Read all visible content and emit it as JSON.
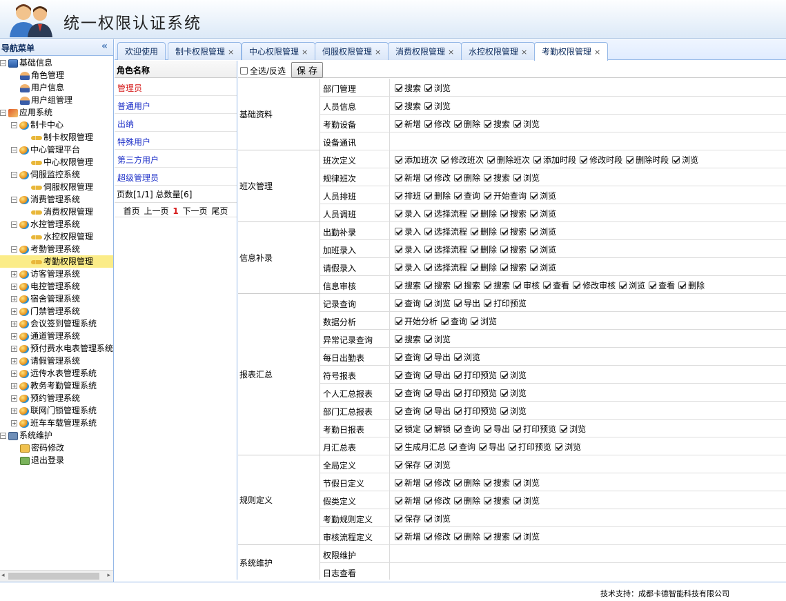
{
  "app": {
    "title": "统一权限认证系统"
  },
  "nav": {
    "title": "导航菜单",
    "tree": [
      {
        "level": 0,
        "toggle": "-",
        "icon": "grid-icon",
        "label": "基础信息"
      },
      {
        "level": 1,
        "icon": "role-icon",
        "label": "角色管理"
      },
      {
        "level": 1,
        "icon": "user-icon",
        "label": "用户信息"
      },
      {
        "level": 1,
        "icon": "user-group-icon",
        "label": "用户组管理"
      },
      {
        "level": 0,
        "toggle": "-",
        "icon": "home-icon",
        "label": "应用系统"
      },
      {
        "level": 1,
        "toggle": "-",
        "icon": "globe-icon",
        "label": "制卡中心"
      },
      {
        "level": 2,
        "icon": "key-icon",
        "label": "制卡权限管理"
      },
      {
        "level": 1,
        "toggle": "-",
        "icon": "globe-icon",
        "label": "中心管理平台"
      },
      {
        "level": 2,
        "icon": "key-icon",
        "label": "中心权限管理"
      },
      {
        "level": 1,
        "toggle": "-",
        "icon": "globe-icon",
        "label": "伺服监控系统"
      },
      {
        "level": 2,
        "icon": "key-icon",
        "label": "伺服权限管理"
      },
      {
        "level": 1,
        "toggle": "-",
        "icon": "globe-icon",
        "label": "消费管理系统"
      },
      {
        "level": 2,
        "icon": "key-icon",
        "label": "消费权限管理"
      },
      {
        "level": 1,
        "toggle": "-",
        "icon": "globe-icon",
        "label": "水控管理系统"
      },
      {
        "level": 2,
        "icon": "key-icon",
        "label": "水控权限管理"
      },
      {
        "level": 1,
        "toggle": "-",
        "icon": "globe-icon",
        "label": "考勤管理系统"
      },
      {
        "level": 2,
        "icon": "key-icon",
        "label": "考勤权限管理",
        "selected": true
      },
      {
        "level": 1,
        "toggle": "+",
        "icon": "globe-icon",
        "label": "访客管理系统"
      },
      {
        "level": 1,
        "toggle": "+",
        "icon": "globe-icon",
        "label": "电控管理系统"
      },
      {
        "level": 1,
        "toggle": "+",
        "icon": "globe-icon",
        "label": "宿舍管理系统"
      },
      {
        "level": 1,
        "toggle": "+",
        "icon": "globe-icon",
        "label": "门禁管理系统"
      },
      {
        "level": 1,
        "toggle": "+",
        "icon": "globe-icon",
        "label": "会议签到管理系统"
      },
      {
        "level": 1,
        "toggle": "+",
        "icon": "globe-icon",
        "label": "通道管理系统"
      },
      {
        "level": 1,
        "toggle": "+",
        "icon": "globe-icon",
        "label": "预付费水电表管理系统"
      },
      {
        "level": 1,
        "toggle": "+",
        "icon": "globe-icon",
        "label": "请假管理系统"
      },
      {
        "level": 1,
        "toggle": "+",
        "icon": "globe-icon",
        "label": "远传水表管理系统"
      },
      {
        "level": 1,
        "toggle": "+",
        "icon": "globe-icon",
        "label": "教务考勤管理系统"
      },
      {
        "level": 1,
        "toggle": "+",
        "icon": "globe-icon",
        "label": "预约管理系统"
      },
      {
        "level": 1,
        "toggle": "+",
        "icon": "globe-icon",
        "label": "联网门锁管理系统"
      },
      {
        "level": 1,
        "toggle": "+",
        "icon": "globe-icon",
        "label": "班车车载管理系统"
      },
      {
        "level": 0,
        "toggle": "-",
        "icon": "monitor-icon",
        "label": "系统维护"
      },
      {
        "level": 1,
        "icon": "password-icon",
        "label": "密码修改"
      },
      {
        "level": 1,
        "icon": "exit-icon",
        "label": "退出登录"
      }
    ]
  },
  "tabs": [
    {
      "label": "欢迎使用",
      "closable": false
    },
    {
      "label": "制卡权限管理",
      "closable": true
    },
    {
      "label": "中心权限管理",
      "closable": true
    },
    {
      "label": "伺服权限管理",
      "closable": true
    },
    {
      "label": "消费权限管理",
      "closable": true
    },
    {
      "label": "水控权限管理",
      "closable": true
    },
    {
      "label": "考勤权限管理",
      "closable": true,
      "active": true
    }
  ],
  "roles": {
    "header": "角色名称",
    "items": [
      {
        "name": "管理员",
        "selected": true
      },
      {
        "name": "普通用户"
      },
      {
        "name": "出纳"
      },
      {
        "name": "特殊用户"
      },
      {
        "name": "第三方用户"
      },
      {
        "name": "超级管理员"
      }
    ],
    "pager_info": "页数[1/1]  总数量[6]",
    "pager": {
      "first": "首页",
      "prev": "上一页",
      "current": "1",
      "next": "下一页",
      "last": "尾页"
    }
  },
  "toolbar": {
    "select_all_label": "全选/反选",
    "save_label": "保 存"
  },
  "permissions": [
    {
      "group": "基础资料",
      "modules": [
        {
          "name": "部门管理",
          "actions": [
            "搜索",
            "浏览"
          ]
        },
        {
          "name": "人员信息",
          "actions": [
            "搜索",
            "浏览"
          ]
        },
        {
          "name": "考勤设备",
          "actions": [
            "新增",
            "修改",
            "删除",
            "搜索",
            "浏览"
          ]
        },
        {
          "name": "设备通讯",
          "actions": []
        }
      ]
    },
    {
      "group": "班次管理",
      "modules": [
        {
          "name": "班次定义",
          "actions": [
            "添加班次",
            "修改班次",
            "删除班次",
            "添加时段",
            "修改时段",
            "删除时段",
            "浏览"
          ]
        },
        {
          "name": "规律班次",
          "actions": [
            "新增",
            "修改",
            "删除",
            "搜索",
            "浏览"
          ]
        },
        {
          "name": "人员排班",
          "actions": [
            "排班",
            "删除",
            "查询",
            "开始查询",
            "浏览"
          ]
        },
        {
          "name": "人员调班",
          "actions": [
            "录入",
            "选择流程",
            "删除",
            "搜索",
            "浏览"
          ]
        }
      ]
    },
    {
      "group": "信息补录",
      "modules": [
        {
          "name": "出勤补录",
          "actions": [
            "录入",
            "选择流程",
            "删除",
            "搜索",
            "浏览"
          ]
        },
        {
          "name": "加班录入",
          "actions": [
            "录入",
            "选择流程",
            "删除",
            "搜索",
            "浏览"
          ]
        },
        {
          "name": "请假录入",
          "actions": [
            "录入",
            "选择流程",
            "删除",
            "搜索",
            "浏览"
          ]
        },
        {
          "name": "信息审核",
          "actions": [
            "搜索",
            "搜索",
            "搜索",
            "搜索",
            "审核",
            "查看",
            "修改审核",
            "浏览",
            "查看",
            "删除"
          ]
        }
      ]
    },
    {
      "group": "报表汇总",
      "modules": [
        {
          "name": "记录查询",
          "actions": [
            "查询",
            "浏览",
            "导出",
            "打印预览"
          ]
        },
        {
          "name": "数据分析",
          "actions": [
            "开始分析",
            "查询",
            "浏览"
          ]
        },
        {
          "name": "异常记录查询",
          "actions": [
            "搜索",
            "浏览"
          ]
        },
        {
          "name": "每日出勤表",
          "actions": [
            "查询",
            "导出",
            "浏览"
          ]
        },
        {
          "name": "符号报表",
          "actions": [
            "查询",
            "导出",
            "打印预览",
            "浏览"
          ]
        },
        {
          "name": "个人汇总报表",
          "actions": [
            "查询",
            "导出",
            "打印预览",
            "浏览"
          ]
        },
        {
          "name": "部门汇总报表",
          "actions": [
            "查询",
            "导出",
            "打印预览",
            "浏览"
          ]
        },
        {
          "name": "考勤日报表",
          "actions": [
            "锁定",
            "解锁",
            "查询",
            "导出",
            "打印预览",
            "浏览"
          ]
        },
        {
          "name": "月汇总表",
          "actions": [
            "生成月汇总",
            "查询",
            "导出",
            "打印预览",
            "浏览"
          ]
        }
      ]
    },
    {
      "group": "规则定义",
      "modules": [
        {
          "name": "全局定义",
          "actions": [
            "保存",
            "浏览"
          ]
        },
        {
          "name": "节假日定义",
          "actions": [
            "新增",
            "修改",
            "删除",
            "搜索",
            "浏览"
          ]
        },
        {
          "name": "假类定义",
          "actions": [
            "新增",
            "修改",
            "删除",
            "搜索",
            "浏览"
          ]
        },
        {
          "name": "考勤规则定义",
          "actions": [
            "保存",
            "浏览"
          ]
        },
        {
          "name": "审核流程定义",
          "actions": [
            "新增",
            "修改",
            "删除",
            "搜索",
            "浏览"
          ]
        }
      ]
    },
    {
      "group": "系统维护",
      "modules": [
        {
          "name": "权限维护",
          "actions": []
        },
        {
          "name": "日志查看",
          "actions": []
        }
      ]
    }
  ],
  "footer": {
    "text": "技术支持：成都卡德智能科技有限公司"
  }
}
